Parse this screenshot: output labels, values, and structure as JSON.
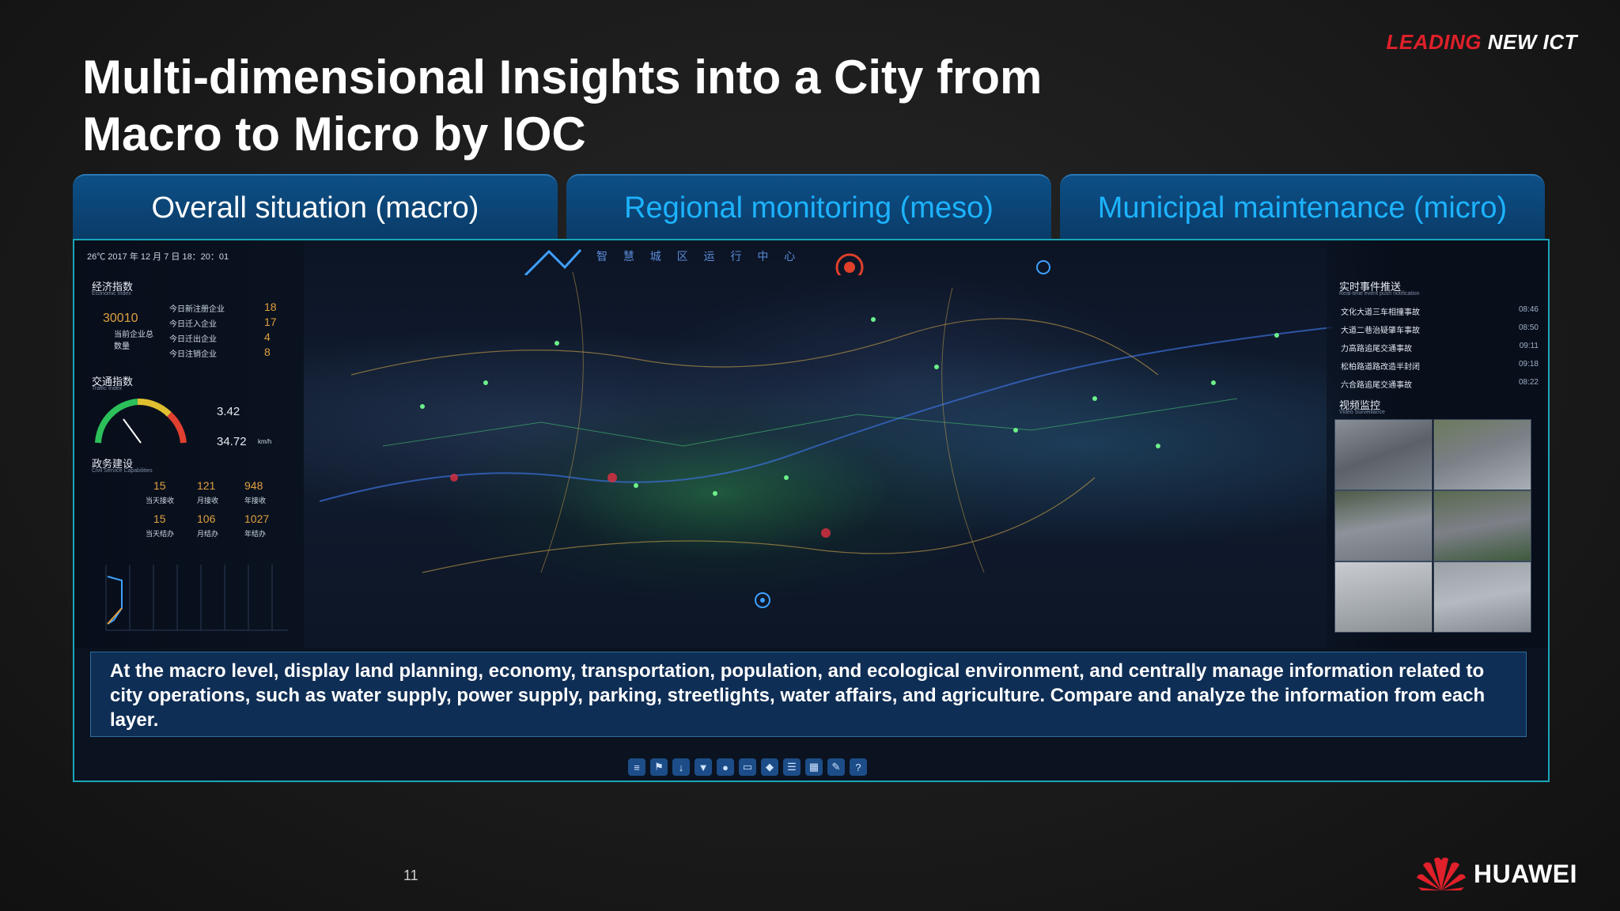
{
  "tagline": {
    "red": "LEADING",
    "white": "NEW ICT"
  },
  "title": "Multi-dimensional Insights into a City from Macro to Micro by IOC",
  "tabs": [
    {
      "label": "Overall situation (macro)"
    },
    {
      "label": "Regional monitoring (meso)"
    },
    {
      "label": "Municipal maintenance (micro)"
    }
  ],
  "dashboard": {
    "weather": "26℃ 2017 年 12 月 7 日 18：20：01",
    "economy": {
      "title": "经济指数",
      "subtitle": "Economic Index",
      "big_value": "30010",
      "big_label": "当前企业总数量",
      "items": [
        {
          "label": "今日新注册企业",
          "value": "18"
        },
        {
          "label": "今日迁入企业",
          "value": "17"
        },
        {
          "label": "今日迁出企业",
          "value": "4"
        },
        {
          "label": "今日注销企业",
          "value": "8"
        }
      ]
    },
    "traffic": {
      "title": "交通指数",
      "subtitle": "Traffic Index",
      "index_value": "3.42",
      "speed_value": "34.72",
      "speed_unit": "km/h"
    },
    "gov": {
      "title": "政务建设",
      "subtitle": "Civil Service Capabilities",
      "row1": [
        {
          "value": "15",
          "label": "当天接收"
        },
        {
          "value": "121",
          "label": "月接收"
        },
        {
          "value": "948",
          "label": "年接收"
        }
      ],
      "row2": [
        {
          "value": "15",
          "label": "当天结办"
        },
        {
          "value": "106",
          "label": "月结办"
        },
        {
          "value": "1027",
          "label": "年结办"
        }
      ]
    },
    "center_title": "智 慧 城 区 运 行 中 心",
    "realtime": {
      "title": "实时事件推送",
      "subtitle": "Real-time event push notification",
      "events": [
        {
          "text": "文化大道三车相撞事故",
          "time": "08:46"
        },
        {
          "text": "大道二巷治疑肇车事故",
          "time": "08:50"
        },
        {
          "text": "力高路追尾交通事故",
          "time": "09:11"
        },
        {
          "text": "松柏路道路改造半封闭",
          "time": "09:18"
        },
        {
          "text": "六合路追尾交通事故",
          "time": "08:22"
        }
      ]
    },
    "video": {
      "title": "视频监控",
      "subtitle": "Video Surveillance"
    }
  },
  "caption": "At the macro level, display land planning, economy, transportation, population, and ecological environment, and centrally manage information related to city operations, such as water supply, power supply, parking, streetlights, water affairs, and agriculture. Compare and analyze the information from each layer.",
  "toolbar_icons": [
    "layers-icon",
    "flag-icon",
    "download-icon",
    "filter-icon",
    "info-icon",
    "monitor-icon",
    "en-icon",
    "list-icon",
    "grid-icon",
    "edit-icon",
    "help-icon"
  ],
  "page_number": "11",
  "logo_text": "HUAWEI",
  "colors": {
    "accent_blue": "#1db3ff",
    "brand_red": "#e0202a",
    "tab_bg": "#0d4f86",
    "frame": "#1aa6b9"
  }
}
